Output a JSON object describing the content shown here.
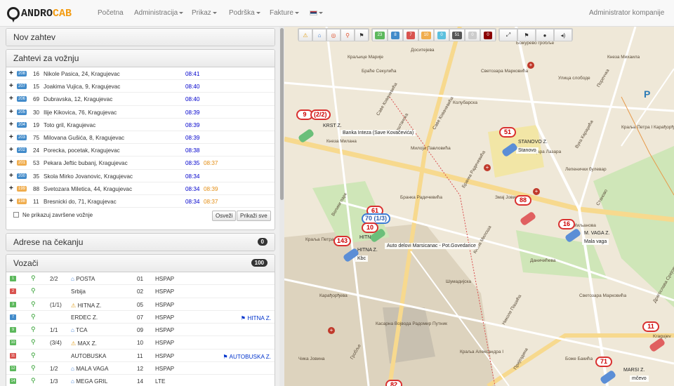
{
  "brand": {
    "part1": "ANDRO",
    "part2": "CAB"
  },
  "nav": {
    "home": "Početna",
    "admin": "Administracija",
    "view": "Prikaz",
    "support": "Podrška",
    "invoices": "Fakture",
    "user": "Administrator kompanije"
  },
  "panels": {
    "new_request": "Nov zahtev",
    "requests": "Zahtevi za vožnju",
    "pending": "Adrese na čekanju",
    "pending_count": "0",
    "drivers": "Vozači",
    "drivers_count": "100"
  },
  "requests": [
    {
      "id": "208",
      "count": "16",
      "address": "Nikole Pasica, 24, Kragujevac",
      "time": "08:41",
      "time2": "",
      "id_color": "blue"
    },
    {
      "id": "207",
      "count": "15",
      "address": "Joakima Vujica, 9, Kragujevac",
      "time": "08:40",
      "time2": "",
      "id_color": "blue"
    },
    {
      "id": "206",
      "count": "69",
      "address": "Dubravska, 12, Kragujevac",
      "time": "08:40",
      "time2": "",
      "id_color": "blue"
    },
    {
      "id": "205",
      "count": "30",
      "address": "Ilije Kikovica, 76, Kragujevac",
      "time": "08:39",
      "time2": "",
      "id_color": "blue"
    },
    {
      "id": "204",
      "count": "19",
      "address": "Toto gril, Kragujevac",
      "time": "08:39",
      "time2": "",
      "id_color": "blue"
    },
    {
      "id": "203",
      "count": "75",
      "address": "Milovana Gušića, 8, Kragujevac",
      "time": "08:39",
      "time2": "",
      "id_color": "blue"
    },
    {
      "id": "202",
      "count": "24",
      "address": "Porecka, pocetak, Kragujevac",
      "time": "08:38",
      "time2": "",
      "id_color": "blue"
    },
    {
      "id": "201",
      "count": "53",
      "address": "Pekara Jeftic bubanj, Kragujevac",
      "time": "08:35",
      "time2": "08:37",
      "id_color": "orange"
    },
    {
      "id": "200",
      "count": "35",
      "address": "Skola Mirko Jovanovic, Kragujevac",
      "time": "08:34",
      "time2": "",
      "id_color": "blue"
    },
    {
      "id": "199",
      "count": "88",
      "address": "Svetozara Miletica, 44, Kragujevac",
      "time": "08:34",
      "time2": "08:39",
      "id_color": "orange"
    },
    {
      "id": "198",
      "count": "11",
      "address": "Bresnicki do, 71, Kragujevac",
      "time": "08:34",
      "time2": "08:37",
      "id_color": "orange"
    }
  ],
  "req_footer": {
    "checkbox": "Ne prikazuj završene vožnje",
    "refresh": "Osveži",
    "show_all": "Prikaži sve"
  },
  "drivers": [
    {
      "sq": "1",
      "sqc": "#5cb85c",
      "cap": "2/2",
      "icon": "home",
      "name": "POSTA",
      "num": "01",
      "status": "HSPAP",
      "dest": ""
    },
    {
      "sq": "2",
      "sqc": "#d9534f",
      "cap": "",
      "icon": "",
      "name": "Srbija",
      "num": "02",
      "status": "HSPAP",
      "dest": ""
    },
    {
      "sq": "3",
      "sqc": "#5cb85c",
      "cap": "(1/1)",
      "icon": "warn",
      "name": "HITNA Z.",
      "num": "05",
      "status": "HSPAP",
      "dest": ""
    },
    {
      "sq": "7",
      "sqc": "#428bca",
      "cap": "",
      "icon": "",
      "name": "ERDEC Z.",
      "num": "07",
      "status": "HSPAP",
      "dest": "HITNA Z."
    },
    {
      "sq": "9",
      "sqc": "#5cb85c",
      "cap": "1/1",
      "icon": "home",
      "name": "TCA",
      "num": "09",
      "status": "HSPAP",
      "dest": ""
    },
    {
      "sq": "10",
      "sqc": "#5cb85c",
      "cap": "(3/4)",
      "icon": "warn",
      "name": "MAX Z.",
      "num": "10",
      "status": "HSPAP",
      "dest": ""
    },
    {
      "sq": "11",
      "sqc": "#d9534f",
      "cap": "",
      "icon": "",
      "name": "AUTOBUSKA",
      "num": "11",
      "status": "HSPAP",
      "dest": "AUTOBUSKA Z."
    },
    {
      "sq": "12",
      "sqc": "#5cb85c",
      "cap": "1/2",
      "icon": "home",
      "name": "MALA VAGA",
      "num": "12",
      "status": "HSPAP",
      "dest": ""
    },
    {
      "sq": "14",
      "sqc": "#5cb85c",
      "cap": "1/3",
      "icon": "home",
      "name": "MEGA GRIL",
      "num": "14",
      "status": "LTE",
      "dest": ""
    }
  ],
  "toolbar_counts": [
    {
      "v": "23",
      "c": "#5cb85c"
    },
    {
      "v": "8",
      "c": "#428bca"
    },
    {
      "v": "7",
      "c": "#d9534f"
    },
    {
      "v": "10",
      "c": "#f0ad4e"
    },
    {
      "v": "0",
      "c": "#5bc0de"
    },
    {
      "v": "51",
      "c": "#555"
    },
    {
      "v": "0",
      "c": "#ccc"
    },
    {
      "v": "0",
      "c": "#8b0000"
    }
  ],
  "map": {
    "markers": [
      {
        "t": "9",
        "c": "red"
      },
      {
        "t": "(2/2)",
        "c": "red"
      },
      {
        "t": "51",
        "c": "red"
      },
      {
        "t": "88",
        "c": "red"
      },
      {
        "t": "16",
        "c": "red"
      },
      {
        "t": "61",
        "c": "red"
      },
      {
        "t": "70 (1/3)",
        "c": "blue"
      },
      {
        "t": "10",
        "c": "red"
      },
      {
        "t": "143",
        "c": "red"
      },
      {
        "t": "11",
        "c": "red"
      },
      {
        "t": "71",
        "c": "red"
      },
      {
        "t": "82",
        "c": "red"
      }
    ],
    "labels": [
      "KRST Z.",
      "Banka Inteza (Save Kovačevića)",
      "STANOVO Z.",
      "Stanovo",
      "M. VAGA Z.",
      "Mala vaga",
      "HITNA Z.",
      "Auto delovi Marsicanac - Pot.Govedarice",
      "HITNA Z.",
      "Kbc",
      "MARSI Z.",
      "mčevo"
    ],
    "streets": [
      "Браће Секулића",
      "Саве Ковачевића",
      "Колубарска",
      "Светозара Марковића",
      "Пештанска",
      "Кнеза Милана",
      "Змај Јовина",
      "Вука Караџића",
      "Улица слободе",
      "Кнеза Михаила",
      "Велики парк",
      "Бранка Радичевића",
      "Краља Петра I",
      "Николе Пашића",
      "Даничићева",
      "Лепенички булевар",
      "Драгослава Срејовића",
      "Касарна Војвода Радомир Путник",
      "Краља Александра I",
      "Саве Ковачевића",
      "Шумадијска",
      "Карађорђева",
      "Пријездина",
      "Светозара Марковића",
      "Милоја Павловића",
      "Кнеза Милоша",
      "Боже Бакића",
      "Чика Јовина",
      "Бранка Радичевића",
      "Краљице Марије",
      "Доситејева",
      "Пореччка",
      "Цара Лазара",
      "Марка Миљанова",
      "Станово",
      "Божурево гробље",
      "Краља Петра I Карађорђевића",
      "Гробље",
      "Kragujev"
    ]
  }
}
